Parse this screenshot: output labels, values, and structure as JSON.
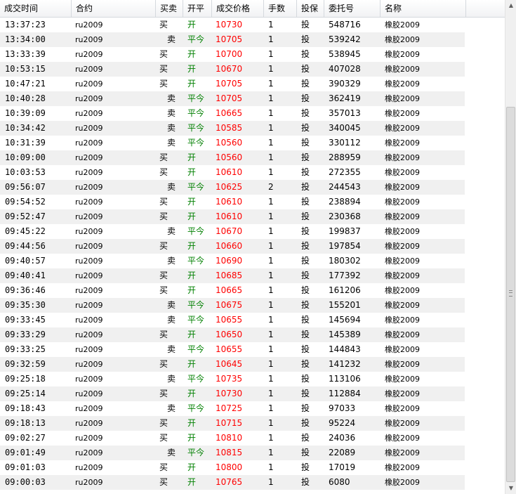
{
  "columns": {
    "time": "成交时间",
    "contract": "合约",
    "side": "买卖",
    "open_close": "开平",
    "price": "成交价格",
    "qty": "手数",
    "hedge": "投保",
    "order_no": "委托号",
    "name": "名称"
  },
  "colors": {
    "price": "#ff0000",
    "open_close": "#008000",
    "row_alt": "#f0f0f0"
  },
  "rows": [
    {
      "time": "13:37:23",
      "contract": "ru2009",
      "side": "买",
      "open_close": "开",
      "price": "10730",
      "qty": "1",
      "hedge": "投",
      "order_no": "548716",
      "name": "橡胶2009"
    },
    {
      "time": "13:34:00",
      "contract": "ru2009",
      "side": "卖",
      "open_close": "平今",
      "price": "10705",
      "qty": "1",
      "hedge": "投",
      "order_no": "539242",
      "name": "橡胶2009"
    },
    {
      "time": "13:33:39",
      "contract": "ru2009",
      "side": "买",
      "open_close": "开",
      "price": "10700",
      "qty": "1",
      "hedge": "投",
      "order_no": "538945",
      "name": "橡胶2009"
    },
    {
      "time": "10:53:15",
      "contract": "ru2009",
      "side": "买",
      "open_close": "开",
      "price": "10670",
      "qty": "1",
      "hedge": "投",
      "order_no": "407028",
      "name": "橡胶2009"
    },
    {
      "time": "10:47:21",
      "contract": "ru2009",
      "side": "买",
      "open_close": "开",
      "price": "10705",
      "qty": "1",
      "hedge": "投",
      "order_no": "390329",
      "name": "橡胶2009"
    },
    {
      "time": "10:40:28",
      "contract": "ru2009",
      "side": "卖",
      "open_close": "平今",
      "price": "10705",
      "qty": "1",
      "hedge": "投",
      "order_no": "362419",
      "name": "橡胶2009"
    },
    {
      "time": "10:39:09",
      "contract": "ru2009",
      "side": "卖",
      "open_close": "平今",
      "price": "10665",
      "qty": "1",
      "hedge": "投",
      "order_no": "357013",
      "name": "橡胶2009"
    },
    {
      "time": "10:34:42",
      "contract": "ru2009",
      "side": "卖",
      "open_close": "平今",
      "price": "10585",
      "qty": "1",
      "hedge": "投",
      "order_no": "340045",
      "name": "橡胶2009"
    },
    {
      "time": "10:31:39",
      "contract": "ru2009",
      "side": "卖",
      "open_close": "平今",
      "price": "10560",
      "qty": "1",
      "hedge": "投",
      "order_no": "330112",
      "name": "橡胶2009"
    },
    {
      "time": "10:09:00",
      "contract": "ru2009",
      "side": "买",
      "open_close": "开",
      "price": "10560",
      "qty": "1",
      "hedge": "投",
      "order_no": "288959",
      "name": "橡胶2009"
    },
    {
      "time": "10:03:53",
      "contract": "ru2009",
      "side": "买",
      "open_close": "开",
      "price": "10610",
      "qty": "1",
      "hedge": "投",
      "order_no": "272355",
      "name": "橡胶2009"
    },
    {
      "time": "09:56:07",
      "contract": "ru2009",
      "side": "卖",
      "open_close": "平今",
      "price": "10625",
      "qty": "2",
      "hedge": "投",
      "order_no": "244543",
      "name": "橡胶2009"
    },
    {
      "time": "09:54:52",
      "contract": "ru2009",
      "side": "买",
      "open_close": "开",
      "price": "10610",
      "qty": "1",
      "hedge": "投",
      "order_no": "238894",
      "name": "橡胶2009"
    },
    {
      "time": "09:52:47",
      "contract": "ru2009",
      "side": "买",
      "open_close": "开",
      "price": "10610",
      "qty": "1",
      "hedge": "投",
      "order_no": "230368",
      "name": "橡胶2009"
    },
    {
      "time": "09:45:22",
      "contract": "ru2009",
      "side": "卖",
      "open_close": "平今",
      "price": "10670",
      "qty": "1",
      "hedge": "投",
      "order_no": "199837",
      "name": "橡胶2009"
    },
    {
      "time": "09:44:56",
      "contract": "ru2009",
      "side": "买",
      "open_close": "开",
      "price": "10660",
      "qty": "1",
      "hedge": "投",
      "order_no": "197854",
      "name": "橡胶2009"
    },
    {
      "time": "09:40:57",
      "contract": "ru2009",
      "side": "卖",
      "open_close": "平今",
      "price": "10690",
      "qty": "1",
      "hedge": "投",
      "order_no": "180302",
      "name": "橡胶2009"
    },
    {
      "time": "09:40:41",
      "contract": "ru2009",
      "side": "买",
      "open_close": "开",
      "price": "10685",
      "qty": "1",
      "hedge": "投",
      "order_no": "177392",
      "name": "橡胶2009"
    },
    {
      "time": "09:36:46",
      "contract": "ru2009",
      "side": "买",
      "open_close": "开",
      "price": "10665",
      "qty": "1",
      "hedge": "投",
      "order_no": "161206",
      "name": "橡胶2009"
    },
    {
      "time": "09:35:30",
      "contract": "ru2009",
      "side": "卖",
      "open_close": "平今",
      "price": "10675",
      "qty": "1",
      "hedge": "投",
      "order_no": "155201",
      "name": "橡胶2009"
    },
    {
      "time": "09:33:45",
      "contract": "ru2009",
      "side": "卖",
      "open_close": "平今",
      "price": "10655",
      "qty": "1",
      "hedge": "投",
      "order_no": "145694",
      "name": "橡胶2009"
    },
    {
      "time": "09:33:29",
      "contract": "ru2009",
      "side": "买",
      "open_close": "开",
      "price": "10650",
      "qty": "1",
      "hedge": "投",
      "order_no": "145389",
      "name": "橡胶2009"
    },
    {
      "time": "09:33:25",
      "contract": "ru2009",
      "side": "卖",
      "open_close": "平今",
      "price": "10655",
      "qty": "1",
      "hedge": "投",
      "order_no": "144843",
      "name": "橡胶2009"
    },
    {
      "time": "09:32:59",
      "contract": "ru2009",
      "side": "买",
      "open_close": "开",
      "price": "10645",
      "qty": "1",
      "hedge": "投",
      "order_no": "141232",
      "name": "橡胶2009"
    },
    {
      "time": "09:25:18",
      "contract": "ru2009",
      "side": "卖",
      "open_close": "平今",
      "price": "10735",
      "qty": "1",
      "hedge": "投",
      "order_no": "113106",
      "name": "橡胶2009"
    },
    {
      "time": "09:25:14",
      "contract": "ru2009",
      "side": "买",
      "open_close": "开",
      "price": "10730",
      "qty": "1",
      "hedge": "投",
      "order_no": "112884",
      "name": "橡胶2009"
    },
    {
      "time": "09:18:43",
      "contract": "ru2009",
      "side": "卖",
      "open_close": "平今",
      "price": "10725",
      "qty": "1",
      "hedge": "投",
      "order_no": "97033",
      "name": "橡胶2009"
    },
    {
      "time": "09:18:13",
      "contract": "ru2009",
      "side": "买",
      "open_close": "开",
      "price": "10715",
      "qty": "1",
      "hedge": "投",
      "order_no": "95224",
      "name": "橡胶2009"
    },
    {
      "time": "09:02:27",
      "contract": "ru2009",
      "side": "买",
      "open_close": "开",
      "price": "10810",
      "qty": "1",
      "hedge": "投",
      "order_no": "24036",
      "name": "橡胶2009"
    },
    {
      "time": "09:01:49",
      "contract": "ru2009",
      "side": "卖",
      "open_close": "平今",
      "price": "10815",
      "qty": "1",
      "hedge": "投",
      "order_no": "22089",
      "name": "橡胶2009"
    },
    {
      "time": "09:01:03",
      "contract": "ru2009",
      "side": "买",
      "open_close": "开",
      "price": "10800",
      "qty": "1",
      "hedge": "投",
      "order_no": "17019",
      "name": "橡胶2009"
    },
    {
      "time": "09:00:03",
      "contract": "ru2009",
      "side": "买",
      "open_close": "开",
      "price": "10765",
      "qty": "1",
      "hedge": "投",
      "order_no": "6080",
      "name": "橡胶2009"
    }
  ]
}
